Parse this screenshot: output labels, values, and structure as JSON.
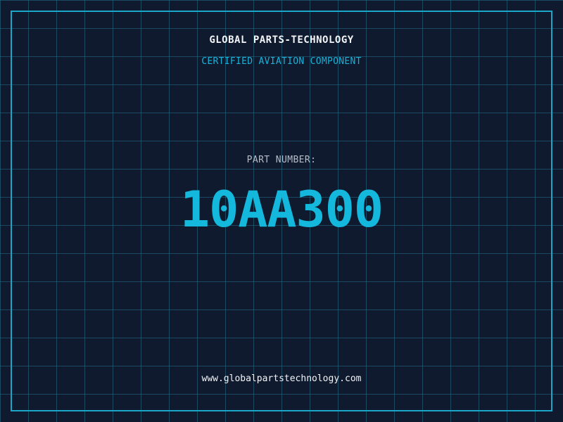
{
  "header": {
    "company": "GLOBAL PARTS-TECHNOLOGY",
    "subtitle": "CERTIFIED AVIATION COMPONENT"
  },
  "part": {
    "label": "PART NUMBER:",
    "number": "10AA300"
  },
  "footer": {
    "website": "www.globalpartstechnology.com"
  },
  "colors": {
    "background": "#0f1a2e",
    "grid": "#2882a0",
    "frame": "#1aa6c9",
    "accent": "#14b8dc",
    "text": "#f2f4f7",
    "muted": "#b5bdc8"
  }
}
